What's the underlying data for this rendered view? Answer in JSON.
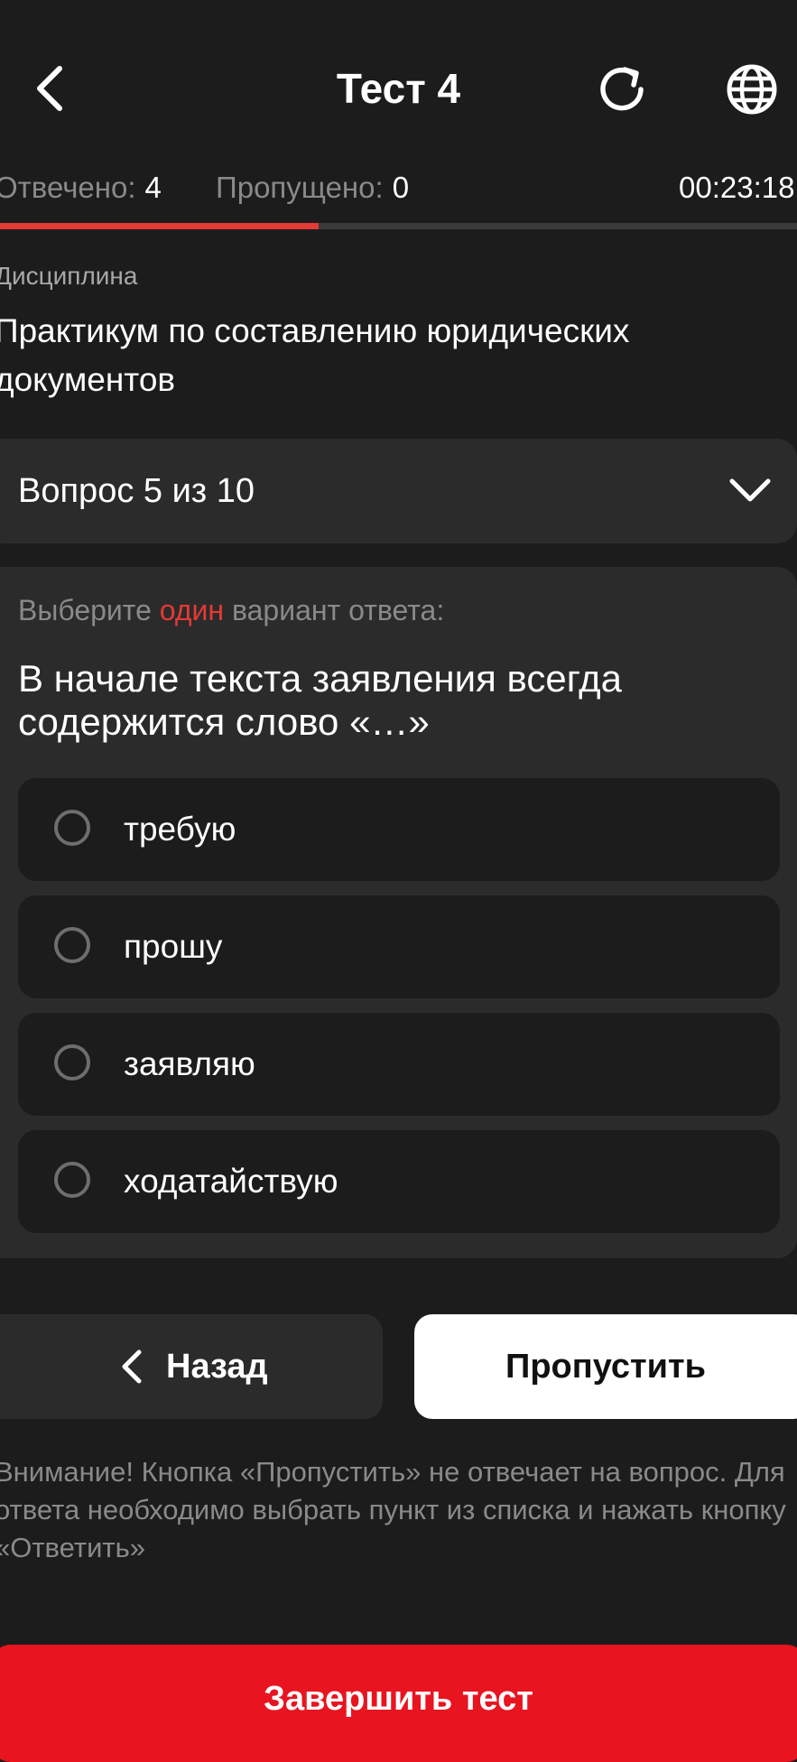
{
  "header": {
    "title": "Тест 4",
    "back_icon": "chevron-left-icon",
    "refresh_icon": "refresh-icon",
    "globe_icon": "globe-icon"
  },
  "stats": {
    "answered_label": "Отвечено:",
    "answered_value": "4",
    "skipped_label": "Пропущено:",
    "skipped_value": "0",
    "timer": "00:23:18"
  },
  "progress": {
    "fraction": 0.4,
    "color": "#e53935"
  },
  "discipline": {
    "label": "Дисциплина",
    "name": "Практикум по составлению юридических документов"
  },
  "question_select": {
    "label": "Вопрос 5 из 10",
    "icon": "chevron-down-icon"
  },
  "question": {
    "instruction_prefix": "Выберите",
    "instruction_accent": "один",
    "instruction_suffix": "вариант ответа:",
    "text": "В начале текста заявления всегда содержится слово «…»",
    "options": [
      "требую",
      "прошу",
      "заявляю",
      "ходатайствую"
    ]
  },
  "buttons": {
    "back": "Назад",
    "skip": "Пропустить",
    "finish": "Завершить тест"
  },
  "warning": "Внимание! Кнопка «Пропустить» не отвечает на вопрос. Для ответа необходимо выбрать пункт из списка и нажать кнопку «Ответить»",
  "colors": {
    "background": "#1c1c1c",
    "card": "#2b2b2b",
    "accent": "#e53935",
    "finish": "#e8141f"
  }
}
